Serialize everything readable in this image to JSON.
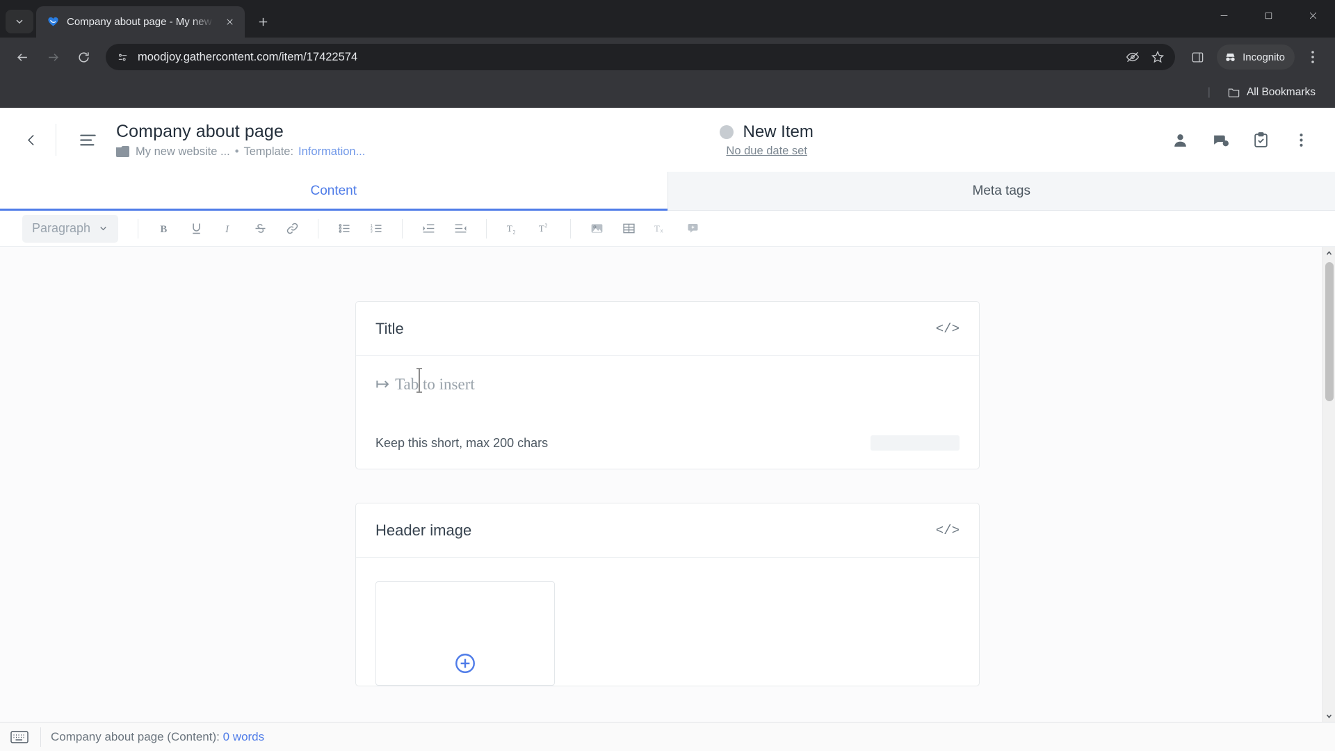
{
  "browser": {
    "tab": {
      "title": "Company about page - My new",
      "favicon_name": "gathercontent-logo-icon"
    },
    "new_tab_label": "+",
    "url": "moodjoy.gathercontent.com/item/17422574",
    "profile_label": "Incognito",
    "bookmarks": {
      "all_bookmarks_label": "All Bookmarks"
    },
    "window_controls": {
      "minimize": "minimize",
      "maximize": "maximize",
      "close": "close"
    }
  },
  "app": {
    "header": {
      "title": "Company about page",
      "breadcrumb_project": "My new website ...",
      "breadcrumb_separator": "•",
      "template_label": "Template:",
      "template_value": "Information...",
      "status_name": "New Item",
      "status_color": "#c7ccd1",
      "due_date": "No due date set",
      "actions": [
        {
          "name": "assignee-icon",
          "label": "Assignee"
        },
        {
          "name": "comments-icon",
          "label": "Comments"
        },
        {
          "name": "checklist-icon",
          "label": "Checklist"
        },
        {
          "name": "more-options-icon",
          "label": "More options"
        }
      ]
    },
    "tabs": [
      {
        "label": "Content",
        "active": true
      },
      {
        "label": "Meta tags",
        "active": false
      }
    ],
    "format_toolbar": {
      "paragraph_label": "Paragraph",
      "buttons": [
        {
          "name": "bold-button",
          "label": "B"
        },
        {
          "name": "underline-button",
          "label": "U"
        },
        {
          "name": "italic-button",
          "label": "I"
        },
        {
          "name": "strikethrough-button",
          "label": "S"
        },
        {
          "name": "link-button",
          "label": "Link"
        },
        {
          "name": "bullet-list-button",
          "label": "Bulleted list"
        },
        {
          "name": "numbered-list-button",
          "label": "Numbered list"
        },
        {
          "name": "indent-button",
          "label": "Indent"
        },
        {
          "name": "outdent-button",
          "label": "Outdent"
        },
        {
          "name": "subscript-button",
          "label": "T2"
        },
        {
          "name": "superscript-button",
          "label": "T2"
        },
        {
          "name": "insert-image-button",
          "label": "Image"
        },
        {
          "name": "insert-table-button",
          "label": "Table"
        },
        {
          "name": "clear-formatting-button",
          "label": "Tx"
        },
        {
          "name": "comment-button",
          "label": "Comment"
        }
      ]
    },
    "fields": [
      {
        "label": "Title",
        "code_glyph": "</>",
        "placeholder": "Tab to insert",
        "tab_glyph": "↦",
        "hint": "Keep this short, max 200 chars",
        "type": "text"
      },
      {
        "label": "Header image",
        "code_glyph": "</>",
        "type": "image"
      }
    ]
  },
  "statusbar": {
    "text": "Company about page (Content):",
    "words": "0 words"
  }
}
